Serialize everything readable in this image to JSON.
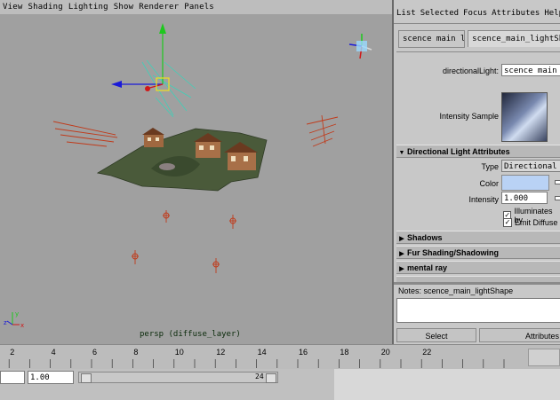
{
  "viewport": {
    "menu": [
      "View",
      "Shading",
      "Lighting",
      "Show",
      "Renderer",
      "Panels"
    ],
    "camera_label": "persp (diffuse_layer)",
    "axis_labels": {
      "x": "x",
      "y": "y",
      "z": "z"
    }
  },
  "attribute_editor": {
    "menu": [
      "List",
      "Selected",
      "Focus",
      "Attributes",
      "Help"
    ],
    "tabs": [
      "scence main light",
      "scence_main_lightShape"
    ],
    "node_label": "directionalLight:",
    "node_value": "scence main light",
    "sample_label": "Intensity Sample",
    "sections": {
      "directional": "Directional Light Attributes",
      "shadows": "Shadows",
      "fur": "Fur Shading/Shadowing",
      "mental_ray": "mental ray"
    },
    "type_label": "Type",
    "type_value": "Directional Light",
    "color_label": "Color",
    "intensity_label": "Intensity",
    "intensity_value": "1.000",
    "illuminates_label": "Illuminates by",
    "emit_diffuse_label": "Emit Diffuse",
    "notes_label": "Notes: scence_main_lightShape",
    "select_label": "Select",
    "attributes_label": "Attributes"
  },
  "colors": {
    "light_color": "#b9d2f5"
  },
  "timeline": {
    "ticks": [
      "2",
      "4",
      "6",
      "8",
      "10",
      "12",
      "14",
      "16",
      "18",
      "20",
      "22"
    ],
    "start_value": "1.00",
    "end_value": "24"
  }
}
